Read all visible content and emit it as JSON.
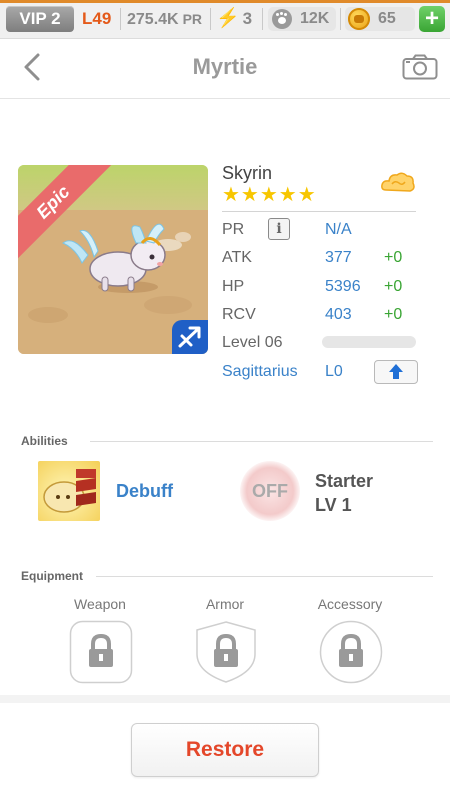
{
  "status_bar": {
    "vip": "VIP 2",
    "level": "L49",
    "pr_value": "275.4K",
    "pr_unit": "PR",
    "energy": "3",
    "paws": "12K",
    "coins": "65",
    "add_label": "+"
  },
  "header": {
    "title": "Myrtie"
  },
  "pet": {
    "rarity": "Epic",
    "name": "Skyrin",
    "stars": "★★★★★",
    "star_count": 5,
    "stats": [
      {
        "label": "PR",
        "value": "N/A",
        "bonus": ""
      },
      {
        "label": "ATK",
        "value": "377",
        "bonus": "+0"
      },
      {
        "label": "HP",
        "value": "5396",
        "bonus": "+0"
      },
      {
        "label": "RCV",
        "value": "403",
        "bonus": "+0"
      }
    ],
    "level_label": "Level 06",
    "level_progress": 0,
    "constellation": "Sagittarius",
    "constellation_level": "L0"
  },
  "abilities": {
    "heading": "Abilities",
    "primary": "Debuff",
    "secondary_state": "OFF",
    "secondary_name": "Starter",
    "secondary_level": "LV 1"
  },
  "equipment": {
    "heading": "Equipment",
    "slots": [
      "Weapon",
      "Armor",
      "Accessory"
    ]
  },
  "actions": {
    "restore_label": "Restore"
  },
  "colors": {
    "accent_blue": "#3a82c9",
    "bonus_green": "#3aa534",
    "restore_red": "#e4472a",
    "epic_ribbon": "#e96b6b",
    "star_gold": "#f7c600"
  }
}
